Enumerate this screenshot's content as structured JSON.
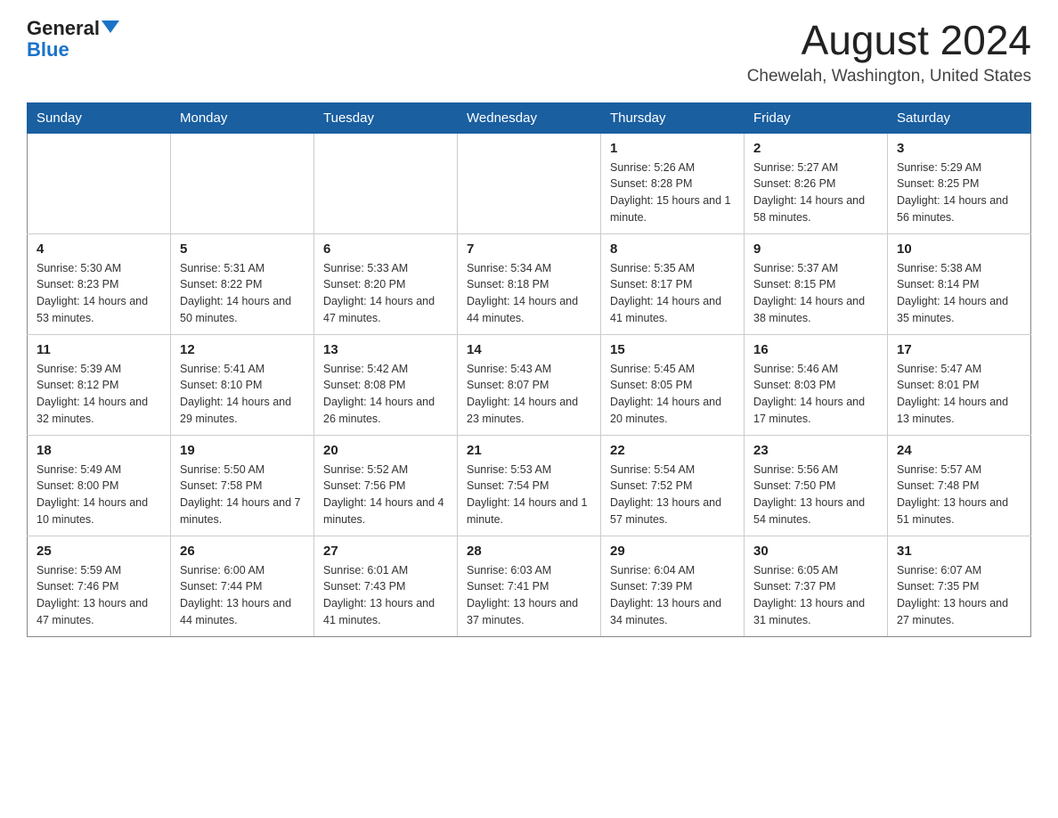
{
  "header": {
    "logo_general": "General",
    "logo_blue": "Blue",
    "title": "August 2024",
    "subtitle": "Chewelah, Washington, United States"
  },
  "days_of_week": [
    "Sunday",
    "Monday",
    "Tuesday",
    "Wednesday",
    "Thursday",
    "Friday",
    "Saturday"
  ],
  "weeks": [
    [
      {
        "day": "",
        "info": ""
      },
      {
        "day": "",
        "info": ""
      },
      {
        "day": "",
        "info": ""
      },
      {
        "day": "",
        "info": ""
      },
      {
        "day": "1",
        "info": "Sunrise: 5:26 AM\nSunset: 8:28 PM\nDaylight: 15 hours and 1 minute."
      },
      {
        "day": "2",
        "info": "Sunrise: 5:27 AM\nSunset: 8:26 PM\nDaylight: 14 hours and 58 minutes."
      },
      {
        "day": "3",
        "info": "Sunrise: 5:29 AM\nSunset: 8:25 PM\nDaylight: 14 hours and 56 minutes."
      }
    ],
    [
      {
        "day": "4",
        "info": "Sunrise: 5:30 AM\nSunset: 8:23 PM\nDaylight: 14 hours and 53 minutes."
      },
      {
        "day": "5",
        "info": "Sunrise: 5:31 AM\nSunset: 8:22 PM\nDaylight: 14 hours and 50 minutes."
      },
      {
        "day": "6",
        "info": "Sunrise: 5:33 AM\nSunset: 8:20 PM\nDaylight: 14 hours and 47 minutes."
      },
      {
        "day": "7",
        "info": "Sunrise: 5:34 AM\nSunset: 8:18 PM\nDaylight: 14 hours and 44 minutes."
      },
      {
        "day": "8",
        "info": "Sunrise: 5:35 AM\nSunset: 8:17 PM\nDaylight: 14 hours and 41 minutes."
      },
      {
        "day": "9",
        "info": "Sunrise: 5:37 AM\nSunset: 8:15 PM\nDaylight: 14 hours and 38 minutes."
      },
      {
        "day": "10",
        "info": "Sunrise: 5:38 AM\nSunset: 8:14 PM\nDaylight: 14 hours and 35 minutes."
      }
    ],
    [
      {
        "day": "11",
        "info": "Sunrise: 5:39 AM\nSunset: 8:12 PM\nDaylight: 14 hours and 32 minutes."
      },
      {
        "day": "12",
        "info": "Sunrise: 5:41 AM\nSunset: 8:10 PM\nDaylight: 14 hours and 29 minutes."
      },
      {
        "day": "13",
        "info": "Sunrise: 5:42 AM\nSunset: 8:08 PM\nDaylight: 14 hours and 26 minutes."
      },
      {
        "day": "14",
        "info": "Sunrise: 5:43 AM\nSunset: 8:07 PM\nDaylight: 14 hours and 23 minutes."
      },
      {
        "day": "15",
        "info": "Sunrise: 5:45 AM\nSunset: 8:05 PM\nDaylight: 14 hours and 20 minutes."
      },
      {
        "day": "16",
        "info": "Sunrise: 5:46 AM\nSunset: 8:03 PM\nDaylight: 14 hours and 17 minutes."
      },
      {
        "day": "17",
        "info": "Sunrise: 5:47 AM\nSunset: 8:01 PM\nDaylight: 14 hours and 13 minutes."
      }
    ],
    [
      {
        "day": "18",
        "info": "Sunrise: 5:49 AM\nSunset: 8:00 PM\nDaylight: 14 hours and 10 minutes."
      },
      {
        "day": "19",
        "info": "Sunrise: 5:50 AM\nSunset: 7:58 PM\nDaylight: 14 hours and 7 minutes."
      },
      {
        "day": "20",
        "info": "Sunrise: 5:52 AM\nSunset: 7:56 PM\nDaylight: 14 hours and 4 minutes."
      },
      {
        "day": "21",
        "info": "Sunrise: 5:53 AM\nSunset: 7:54 PM\nDaylight: 14 hours and 1 minute."
      },
      {
        "day": "22",
        "info": "Sunrise: 5:54 AM\nSunset: 7:52 PM\nDaylight: 13 hours and 57 minutes."
      },
      {
        "day": "23",
        "info": "Sunrise: 5:56 AM\nSunset: 7:50 PM\nDaylight: 13 hours and 54 minutes."
      },
      {
        "day": "24",
        "info": "Sunrise: 5:57 AM\nSunset: 7:48 PM\nDaylight: 13 hours and 51 minutes."
      }
    ],
    [
      {
        "day": "25",
        "info": "Sunrise: 5:59 AM\nSunset: 7:46 PM\nDaylight: 13 hours and 47 minutes."
      },
      {
        "day": "26",
        "info": "Sunrise: 6:00 AM\nSunset: 7:44 PM\nDaylight: 13 hours and 44 minutes."
      },
      {
        "day": "27",
        "info": "Sunrise: 6:01 AM\nSunset: 7:43 PM\nDaylight: 13 hours and 41 minutes."
      },
      {
        "day": "28",
        "info": "Sunrise: 6:03 AM\nSunset: 7:41 PM\nDaylight: 13 hours and 37 minutes."
      },
      {
        "day": "29",
        "info": "Sunrise: 6:04 AM\nSunset: 7:39 PM\nDaylight: 13 hours and 34 minutes."
      },
      {
        "day": "30",
        "info": "Sunrise: 6:05 AM\nSunset: 7:37 PM\nDaylight: 13 hours and 31 minutes."
      },
      {
        "day": "31",
        "info": "Sunrise: 6:07 AM\nSunset: 7:35 PM\nDaylight: 13 hours and 27 minutes."
      }
    ]
  ]
}
